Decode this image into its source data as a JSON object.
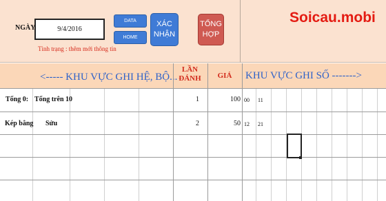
{
  "form": {
    "date_label": "NGÀY :",
    "date_value": "9/4/2016",
    "status": "Tình trạng : thêm mới thông tin"
  },
  "buttons": {
    "data": "DATA",
    "home": "HOME",
    "xac_nhan_line1": "XÁC",
    "xac_nhan_line2": "NHẬN",
    "tong_hop_line1": "TỔNG",
    "tong_hop_line2": "HỢP"
  },
  "watermark": "Soicau.mobi",
  "colors": {
    "panel_bg": "#fbe2d0",
    "header_bg": "#fbd7b8",
    "button_blue": "#3f7bd6",
    "button_red": "#cf5a52",
    "header_blue": "#2e62c9",
    "header_red": "#d22b1c",
    "status_red": "#d62a1b"
  },
  "header": {
    "left_area": "<----- KHU VỰC GHI HỆ, BỘ...",
    "lan_danh_line1": "LẦN",
    "lan_danh_line2": "ĐÁNH",
    "gia": "GIÁ",
    "right_area": "KHU VỰC GHI SỐ ------->"
  },
  "rows": [
    {
      "label": "Tổng 0:",
      "type": "Tổng trên 10",
      "lan": "1",
      "gia": "100",
      "nums": [
        "00",
        "11"
      ]
    },
    {
      "label": "Kép bằng",
      "type": "Sửu",
      "lan": "2",
      "gia": "50",
      "nums": [
        "12",
        "21"
      ]
    }
  ]
}
